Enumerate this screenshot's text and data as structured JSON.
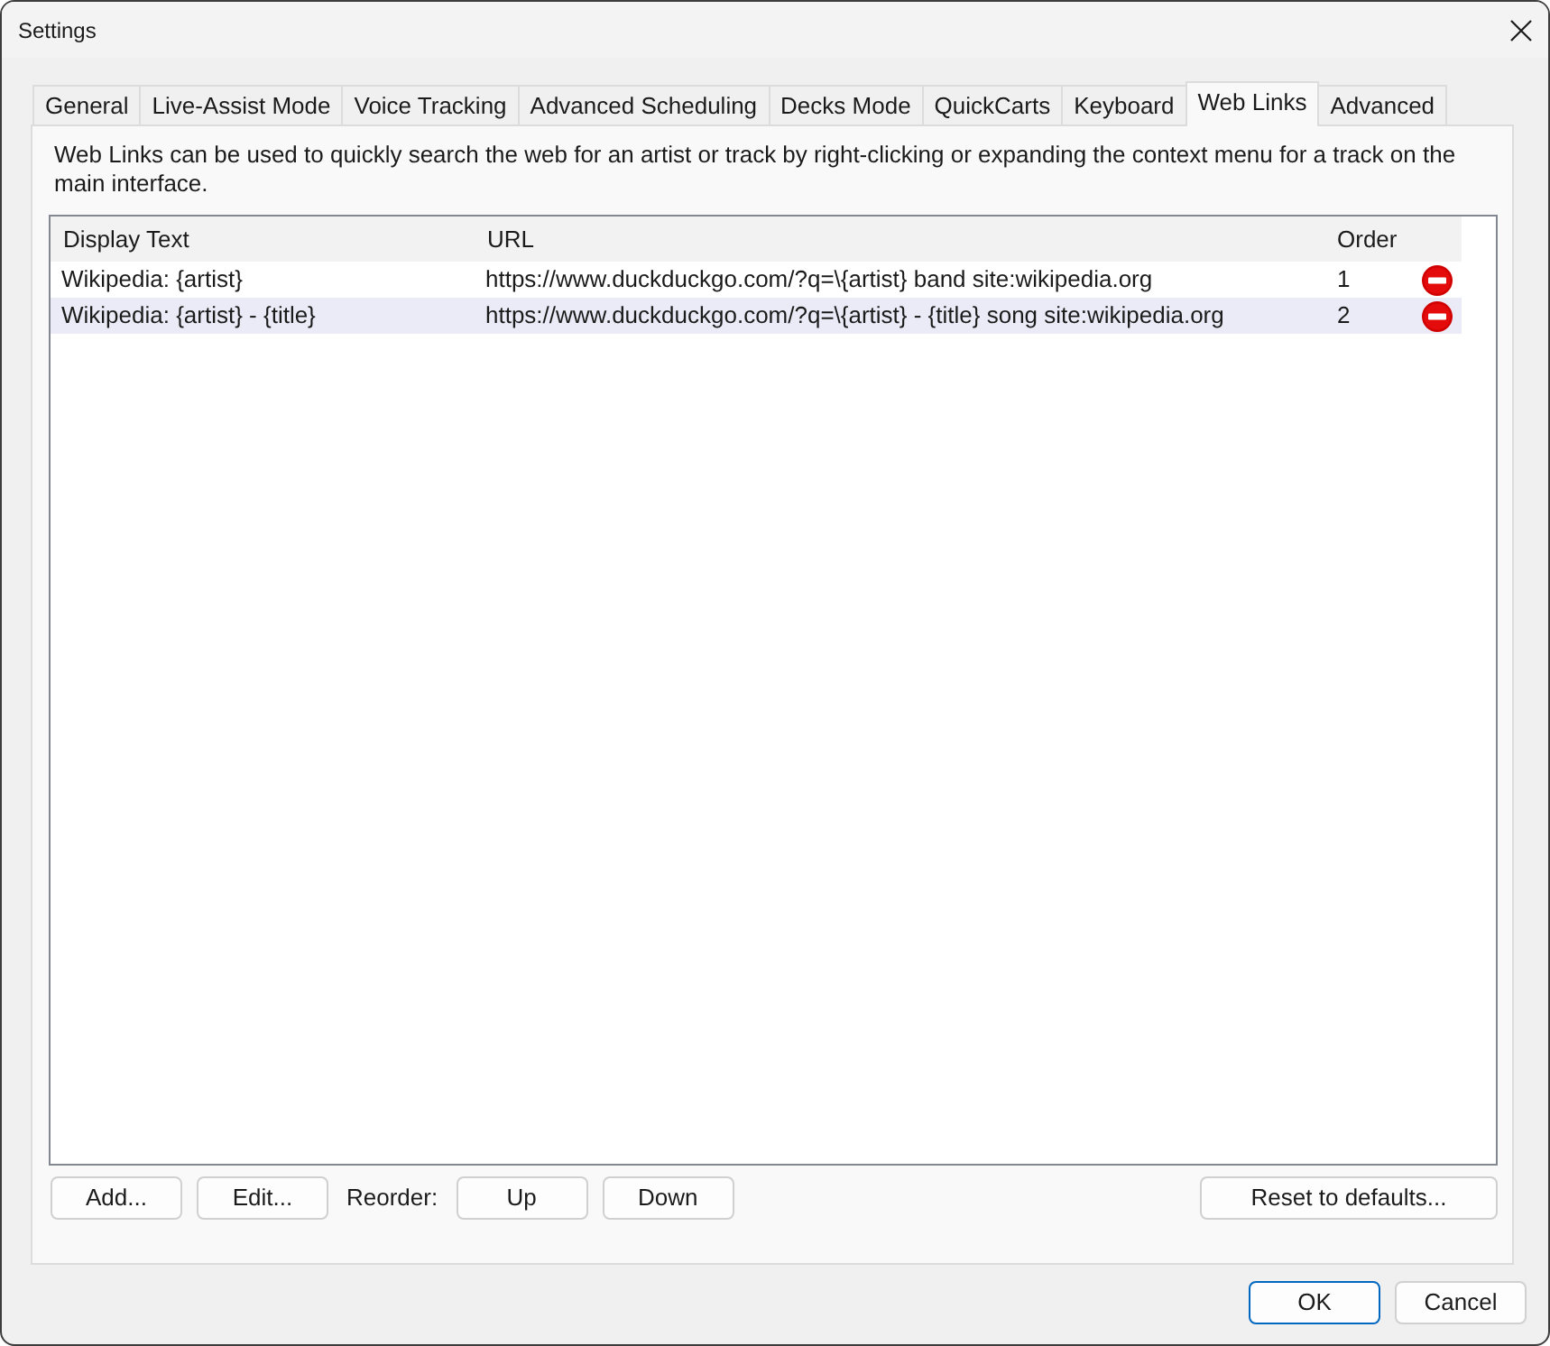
{
  "window": {
    "title": "Settings"
  },
  "tabs": [
    {
      "label": "General",
      "selected": false
    },
    {
      "label": "Live-Assist Mode",
      "selected": false
    },
    {
      "label": "Voice Tracking",
      "selected": false
    },
    {
      "label": "Advanced Scheduling",
      "selected": false
    },
    {
      "label": "Decks Mode",
      "selected": false
    },
    {
      "label": "QuickCarts",
      "selected": false
    },
    {
      "label": "Keyboard",
      "selected": false
    },
    {
      "label": "Web Links",
      "selected": true
    },
    {
      "label": "Advanced",
      "selected": false
    }
  ],
  "description": "Web Links can be used to quickly search the web for an artist or track by right-clicking or expanding the context menu for a track on the main interface.",
  "table": {
    "columns": [
      "Display Text",
      "URL",
      "Order"
    ],
    "rows": [
      {
        "display_text": "Wikipedia: {artist}",
        "url": "https://www.duckduckgo.com/?q=\\{artist} band site:wikipedia.org",
        "order": "1",
        "selected": false
      },
      {
        "display_text": "Wikipedia: {artist} - {title}",
        "url": "https://www.duckduckgo.com/?q=\\{artist} - {title} song site:wikipedia.org",
        "order": "2",
        "selected": true
      }
    ]
  },
  "list_actions": [
    {
      "kind": "button",
      "label": "Add..."
    },
    {
      "kind": "button",
      "label": "Edit..."
    },
    {
      "kind": "label",
      "label": "Reorder:"
    },
    {
      "kind": "button",
      "label": "Up"
    },
    {
      "kind": "button",
      "label": "Down"
    }
  ],
  "reset_button": "Reset to defaults...",
  "dialog_buttons": [
    {
      "label": "OK",
      "default": true
    },
    {
      "label": "Cancel",
      "default": false
    }
  ]
}
